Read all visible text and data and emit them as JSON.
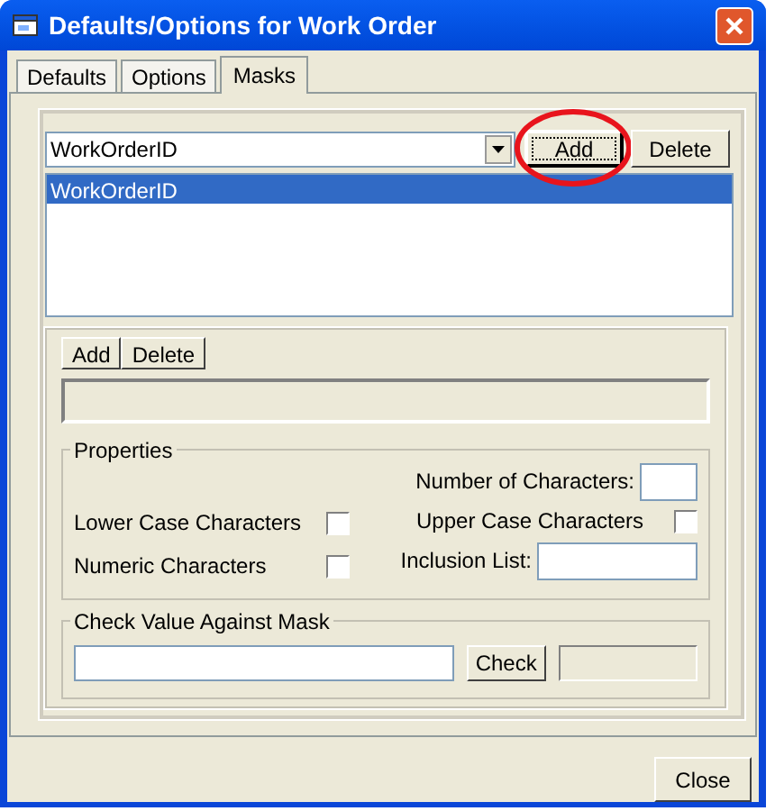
{
  "window": {
    "title": "Defaults/Options for Work Order"
  },
  "tabs": [
    {
      "label": "Defaults",
      "selected": false
    },
    {
      "label": "Options",
      "selected": false
    },
    {
      "label": "Masks",
      "selected": true
    }
  ],
  "mask_select": {
    "value": "WorkOrderID"
  },
  "mask_buttons": [
    {
      "label": "Add",
      "focused": true,
      "circled": true
    },
    {
      "label": "Delete",
      "focused": false,
      "circled": false
    }
  ],
  "mask_list": [
    {
      "label": "WorkOrderID",
      "selected": true
    }
  ],
  "part_buttons": [
    {
      "label": "Add"
    },
    {
      "label": "Delete"
    }
  ],
  "part_field": {
    "disabled": true
  },
  "properties": {
    "title": "Properties",
    "left": [
      {
        "kind": "checkbox",
        "label": "Lower Case Characters",
        "checked": false
      },
      {
        "kind": "checkbox",
        "label": "Numeric Characters",
        "checked": false
      }
    ],
    "right": [
      {
        "kind": "number_field",
        "label": "Number of Characters:"
      },
      {
        "kind": "checkbox",
        "label": "Upper Case Characters",
        "checked": false
      },
      {
        "kind": "text_field",
        "label": "Inclusion List:"
      }
    ]
  },
  "check_group": {
    "title": "Check Value Against Mask",
    "button": "Check",
    "result_disabled": true
  },
  "close_button": "Close"
}
